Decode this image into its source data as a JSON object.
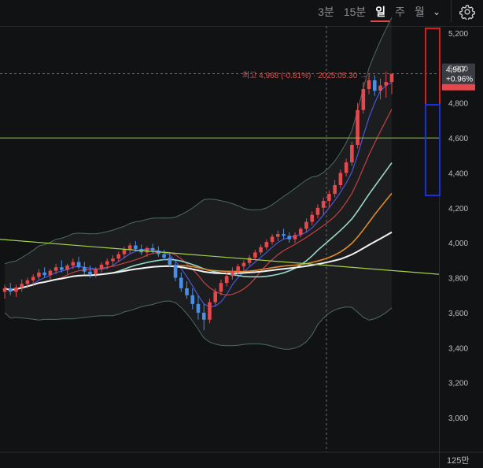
{
  "toolbar": {
    "tabs": [
      {
        "label": "3분",
        "active": false
      },
      {
        "label": "15분",
        "active": false
      },
      {
        "label": "일",
        "active": true
      },
      {
        "label": "주",
        "active": false
      },
      {
        "label": "월",
        "active": false
      }
    ],
    "dropdown_icon": "chevron-down-icon",
    "settings_icon": "gear-icon"
  },
  "price_tag": {
    "price": "4,967",
    "change": "+0.96%",
    "color": "#e5484d"
  },
  "high_note": "최고 4,968 (-0.81%) · 2025.05.30 →",
  "volume_label": "125만",
  "chart_data": {
    "type": "candlestick",
    "ylim": [
      2800,
      5300
    ],
    "y_ticks": [
      3000,
      3200,
      3400,
      3600,
      3800,
      4000,
      4200,
      4400,
      4600,
      4800,
      5000,
      5200
    ],
    "y_tick_labels": [
      "3,000",
      "3,200",
      "3,400",
      "3,600",
      "3,800",
      "4,000",
      "4,200",
      "4,400",
      "4,600",
      "4,800",
      "5,000",
      "5,200"
    ],
    "current_price": 4967,
    "high_price": 4968,
    "horizontal_line": 4600,
    "candles": [
      [
        3720,
        3760,
        3680,
        3740
      ],
      [
        3740,
        3770,
        3700,
        3720
      ],
      [
        3720,
        3760,
        3690,
        3745
      ],
      [
        3745,
        3790,
        3720,
        3765
      ],
      [
        3765,
        3800,
        3740,
        3785
      ],
      [
        3785,
        3820,
        3760,
        3805
      ],
      [
        3805,
        3850,
        3790,
        3830
      ],
      [
        3830,
        3860,
        3800,
        3815
      ],
      [
        3815,
        3850,
        3790,
        3840
      ],
      [
        3840,
        3880,
        3820,
        3860
      ],
      [
        3860,
        3900,
        3830,
        3845
      ],
      [
        3845,
        3880,
        3820,
        3870
      ],
      [
        3870,
        3910,
        3850,
        3890
      ],
      [
        3890,
        3920,
        3850,
        3860
      ],
      [
        3860,
        3890,
        3820,
        3835
      ],
      [
        3835,
        3870,
        3800,
        3820
      ],
      [
        3820,
        3860,
        3800,
        3850
      ],
      [
        3850,
        3890,
        3830,
        3875
      ],
      [
        3875,
        3910,
        3850,
        3895
      ],
      [
        3895,
        3930,
        3870,
        3910
      ],
      [
        3910,
        3950,
        3890,
        3935
      ],
      [
        3935,
        3980,
        3910,
        3960
      ],
      [
        3960,
        4000,
        3940,
        3985
      ],
      [
        3985,
        4010,
        3950,
        3965
      ],
      [
        3965,
        3990,
        3930,
        3945
      ],
      [
        3945,
        3980,
        3920,
        3970
      ],
      [
        3970,
        3995,
        3940,
        3955
      ],
      [
        3955,
        3980,
        3920,
        3935
      ],
      [
        3935,
        3960,
        3900,
        3915
      ],
      [
        3915,
        3940,
        3860,
        3875
      ],
      [
        3875,
        3900,
        3780,
        3800
      ],
      [
        3800,
        3830,
        3720,
        3740
      ],
      [
        3740,
        3780,
        3680,
        3700
      ],
      [
        3700,
        3740,
        3620,
        3650
      ],
      [
        3650,
        3700,
        3560,
        3600
      ],
      [
        3600,
        3650,
        3500,
        3560
      ],
      [
        3560,
        3680,
        3540,
        3660
      ],
      [
        3660,
        3740,
        3640,
        3720
      ],
      [
        3720,
        3790,
        3700,
        3770
      ],
      [
        3770,
        3830,
        3750,
        3810
      ],
      [
        3810,
        3860,
        3790,
        3840
      ],
      [
        3840,
        3880,
        3820,
        3865
      ],
      [
        3865,
        3900,
        3840,
        3885
      ],
      [
        3885,
        3930,
        3870,
        3915
      ],
      [
        3915,
        3960,
        3900,
        3945
      ],
      [
        3945,
        3990,
        3930,
        3975
      ],
      [
        3975,
        4020,
        3960,
        4005
      ],
      [
        4005,
        4050,
        3990,
        4035
      ],
      [
        4035,
        4070,
        4010,
        4050
      ],
      [
        4050,
        4080,
        4020,
        4040
      ],
      [
        4040,
        4060,
        4000,
        4020
      ],
      [
        4020,
        4060,
        4000,
        4045
      ],
      [
        4045,
        4090,
        4030,
        4080
      ],
      [
        4080,
        4140,
        4060,
        4120
      ],
      [
        4120,
        4180,
        4100,
        4160
      ],
      [
        4160,
        4220,
        4140,
        4200
      ],
      [
        4200,
        4260,
        4160,
        4240
      ],
      [
        4240,
        4300,
        4200,
        4280
      ],
      [
        4280,
        4360,
        4260,
        4330
      ],
      [
        4330,
        4420,
        4310,
        4400
      ],
      [
        4400,
        4480,
        4380,
        4460
      ],
      [
        4460,
        4580,
        4440,
        4560
      ],
      [
        4560,
        4800,
        4540,
        4760
      ],
      [
        4760,
        4920,
        4740,
        4880
      ],
      [
        4880,
        4968,
        4850,
        4930
      ],
      [
        4930,
        4960,
        4840,
        4870
      ],
      [
        4870,
        4940,
        4820,
        4900
      ],
      [
        4900,
        4980,
        4830,
        4920
      ],
      [
        4920,
        4967,
        4850,
        4967
      ]
    ]
  }
}
